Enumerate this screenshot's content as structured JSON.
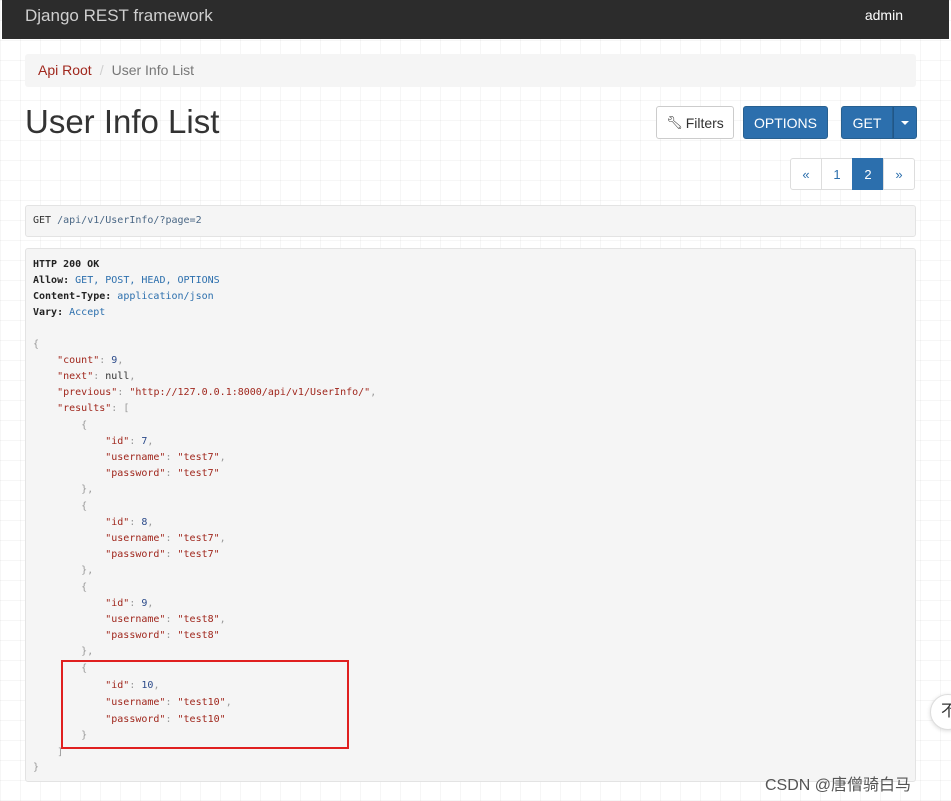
{
  "navbar": {
    "brand": "Django REST framework",
    "user": "admin"
  },
  "breadcrumb": {
    "root": "Api Root",
    "separator": "/",
    "current": "User Info List"
  },
  "page": {
    "title": "User Info List"
  },
  "toolbar": {
    "filters_label": "Filters",
    "filters_icon": "wrench-icon",
    "options_label": "OPTIONS",
    "get_label": "GET"
  },
  "pagination": {
    "prev": "«",
    "pages": [
      "1",
      "2"
    ],
    "active": "2",
    "next": "»"
  },
  "request": {
    "method": "GET",
    "path": "/api/v1/UserInfo/",
    "query": "?page=2"
  },
  "response": {
    "status": "HTTP 200 OK",
    "headers": [
      {
        "key": "Allow",
        "value": "GET, POST, HEAD, OPTIONS"
      },
      {
        "key": "Content-Type",
        "value": "application/json"
      },
      {
        "key": "Vary",
        "value": "Accept"
      }
    ],
    "body": {
      "count": "9",
      "next": "null",
      "previous": "\"http://127.0.0.1:8000/api/v1/UserInfo/\"",
      "results": [
        {
          "id": "7",
          "username": "\"test7\"",
          "password": "\"test7\""
        },
        {
          "id": "8",
          "username": "\"test7\"",
          "password": "\"test7\""
        },
        {
          "id": "9",
          "username": "\"test8\"",
          "password": "\"test8\""
        },
        {
          "id": "10",
          "username": "\"test10\"",
          "password": "\"test10\""
        }
      ]
    }
  },
  "overlay": {
    "scroll_top_glyph": "不",
    "watermark": "CSDN @唐僧骑白马"
  },
  "colors": {
    "navbar": "#2c2c2c",
    "primary": "#2c6fad",
    "link": "#a0271d",
    "highlight": "#e02020"
  }
}
